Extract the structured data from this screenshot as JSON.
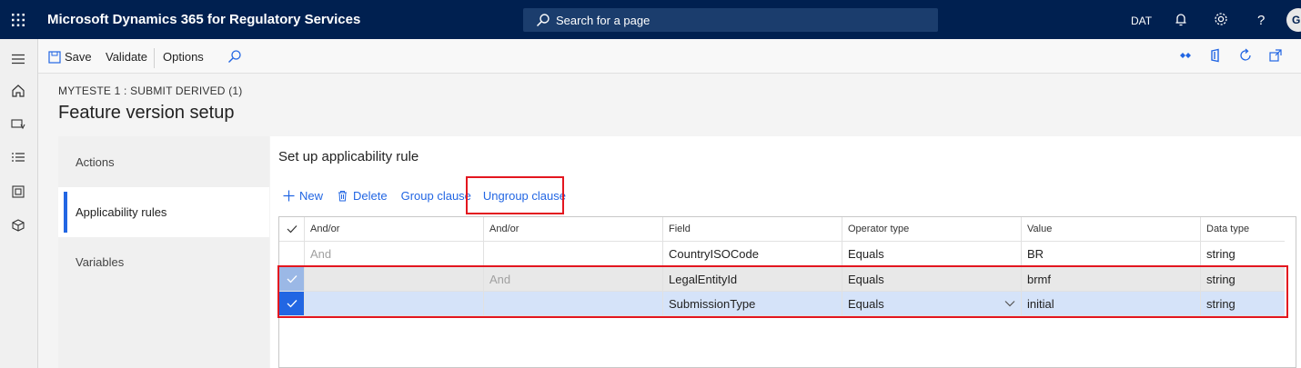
{
  "topbar": {
    "app_title": "Microsoft Dynamics 365 for Regulatory Services",
    "search_placeholder": "Search for a page",
    "company": "DAT",
    "user_initial": "G"
  },
  "actionpane": {
    "save_label": "Save",
    "validate_label": "Validate",
    "options_label": "Options"
  },
  "page": {
    "breadcrumb": "MYTESTE 1 : SUBMIT DERIVED (1)",
    "title": "Feature version setup"
  },
  "tabs": [
    {
      "label": "Actions"
    },
    {
      "label": "Applicability rules"
    },
    {
      "label": "Variables"
    }
  ],
  "section": {
    "title": "Set up applicability rule",
    "toolbar": {
      "new_label": "New",
      "delete_label": "Delete",
      "group_label": "Group clause",
      "ungroup_label": "Ungroup clause"
    }
  },
  "grid": {
    "columns": [
      "And/or",
      "And/or",
      "Field",
      "Operator type",
      "Value",
      "Data type"
    ],
    "rows": [
      {
        "andor1": "And",
        "andor2": "",
        "field": "CountryISOCode",
        "operator": "Equals",
        "value": "BR",
        "datatype": "string"
      },
      {
        "andor1": "",
        "andor2": "And",
        "field": "LegalEntityId",
        "operator": "Equals",
        "value": "brmf",
        "datatype": "string"
      },
      {
        "andor1": "",
        "andor2": "",
        "field": "SubmissionType",
        "operator": "Equals",
        "value": "initial",
        "datatype": "string"
      }
    ]
  },
  "colors": {
    "topbar": "#002050",
    "accent": "#2266e3",
    "highlight": "#e3161f"
  }
}
